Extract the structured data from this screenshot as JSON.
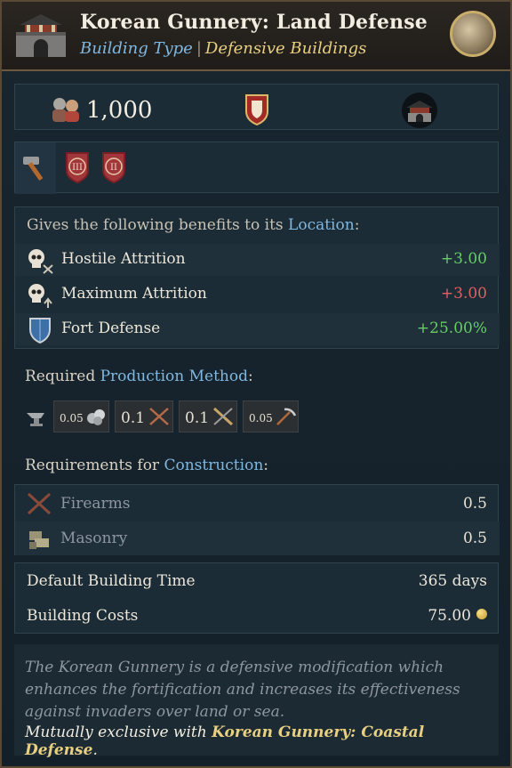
{
  "header": {
    "title": "Korean Gunnery: Land Defense",
    "building_type_label": "Building Type",
    "separator": "|",
    "category": "Defensive Buildings"
  },
  "summary": {
    "population": "1,000"
  },
  "benefits": {
    "heading_prefix": "Gives the following benefits to its",
    "heading_link": "Location",
    "heading_suffix": ":",
    "items": [
      {
        "label": "Hostile Attrition",
        "value": "+3.00",
        "tone": "positive",
        "icon": "skull-crossed-icon"
      },
      {
        "label": "Maximum Attrition",
        "value": "+3.00",
        "tone": "negative",
        "icon": "skull-up-icon"
      },
      {
        "label": "Fort Defense",
        "value": "+25.00%",
        "tone": "positive",
        "icon": "shield-icon"
      }
    ]
  },
  "production": {
    "heading_prefix": "Required",
    "heading_link": "Production Method",
    "heading_suffix": ":",
    "inputs": [
      {
        "amount": "0.05",
        "icon": "stone-icon"
      },
      {
        "amount": "0.1",
        "icon": "crossed-swords-icon"
      },
      {
        "amount": "0.1",
        "icon": "crossed-muskets-icon"
      },
      {
        "amount": "0.05",
        "icon": "pickaxe-icon"
      }
    ]
  },
  "construction": {
    "heading_prefix": "Requirements for",
    "heading_link": "Construction",
    "heading_suffix": ":",
    "items": [
      {
        "label": "Firearms",
        "value": "0.5",
        "icon": "firearms-icon"
      },
      {
        "label": "Masonry",
        "value": "0.5",
        "icon": "masonry-icon"
      }
    ]
  },
  "build": {
    "time_label": "Default Building Time",
    "time_value": "365 days",
    "cost_label": "Building Costs",
    "cost_value": "75.00"
  },
  "description": {
    "text": "The Korean Gunnery is a defensive modification which enhances the fortification and increases its effectiveness against invaders over land or sea.",
    "exclusive_prefix": "Mutually exclusive with",
    "exclusive_name": "Korean Gunnery: Coastal Defense",
    "exclusive_suffix": "."
  },
  "colors": {
    "link": "#7fb8e0",
    "positive": "#66cc66",
    "negative": "#e06060",
    "gold": "#e8cf82"
  }
}
